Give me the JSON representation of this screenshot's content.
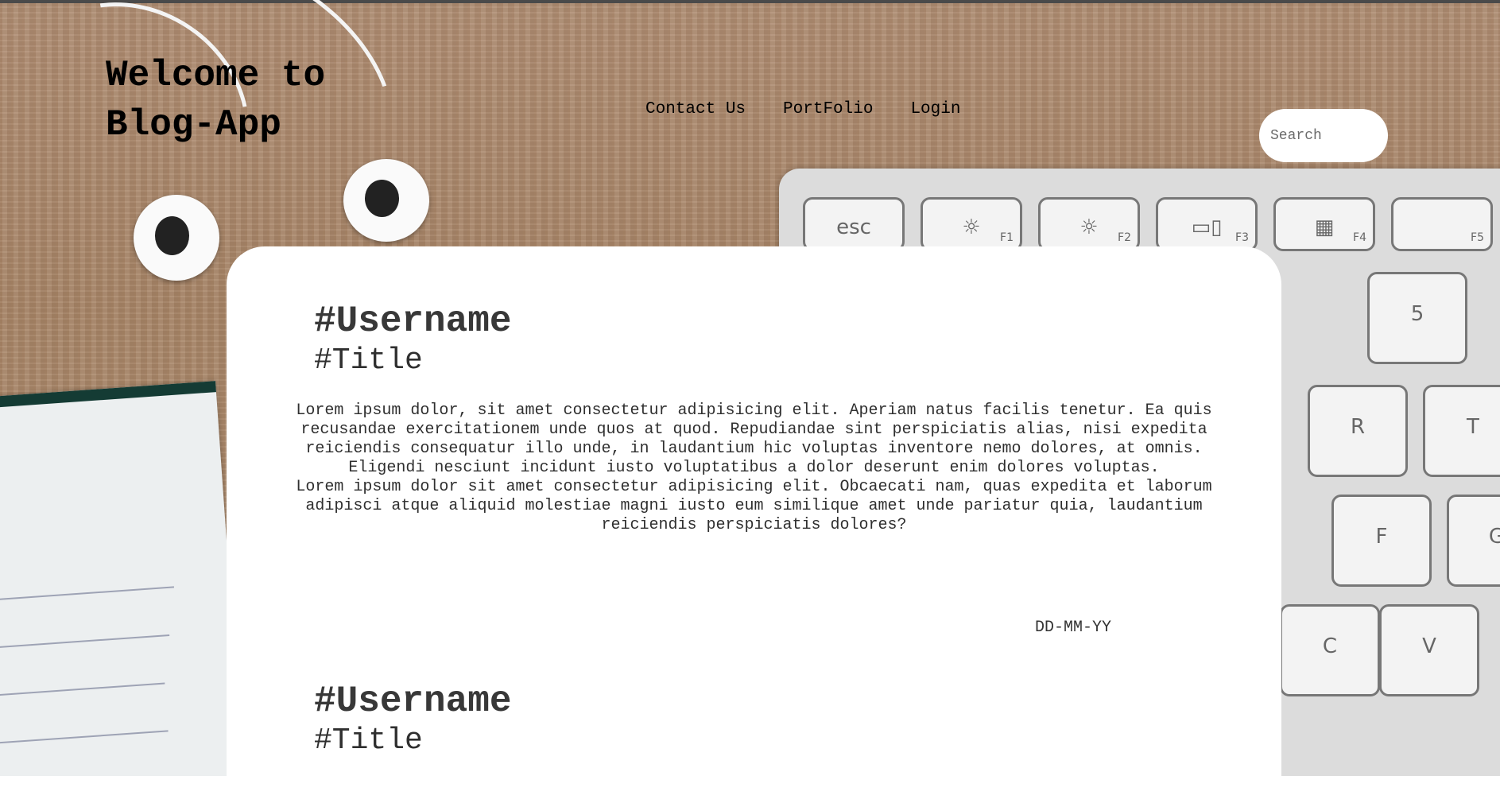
{
  "header": {
    "site_title": "Welcome to\nBlog-App",
    "nav": [
      {
        "label": "Contact Us"
      },
      {
        "label": "PortFolio"
      },
      {
        "label": "Login"
      }
    ],
    "search_placeholder": "Search"
  },
  "posts": [
    {
      "username": "#Username",
      "title": "#Title",
      "body": "Lorem ipsum dolor, sit amet consectetur adipisicing elit. Aperiam natus facilis tenetur. Ea quis recusandae exercitationem unde quos at quod. Repudiandae sint perspiciatis alias, nisi expedita reiciendis consequatur illo unde, in laudantium hic voluptas inventore nemo dolores, at omnis. Eligendi nesciunt incidunt iusto voluptatibus a dolor deserunt enim dolores voluptas.\nLorem ipsum dolor sit amet consectetur adipisicing elit. Obcaecati nam, quas expedita et laborum adipisci atque aliquid molestiae magni iusto eum similique amet unde pariatur quia, laudantium reiciendis perspiciatis dolores?",
      "date": "DD-MM-YY"
    },
    {
      "username": "#Username",
      "title": "#Title"
    }
  ],
  "background": {
    "keyboard_keys": [
      {
        "main": "esc",
        "fn": ""
      },
      {
        "main": "☼",
        "fn": "F1"
      },
      {
        "main": "☼",
        "fn": "F2"
      },
      {
        "main": "▭▯",
        "fn": "F3"
      },
      {
        "main": "▦",
        "fn": "F4"
      },
      {
        "main": "",
        "fn": "F5"
      },
      {
        "main": "5",
        "fn": ""
      },
      {
        "main": "R",
        "fn": ""
      },
      {
        "main": "T",
        "fn": ""
      },
      {
        "main": "F",
        "fn": ""
      },
      {
        "main": "G",
        "fn": ""
      },
      {
        "main": "C",
        "fn": ""
      },
      {
        "main": "V",
        "fn": ""
      }
    ]
  },
  "colors": {
    "card": "#ffffff",
    "title": "#000000",
    "text": "#2f2f2f"
  }
}
